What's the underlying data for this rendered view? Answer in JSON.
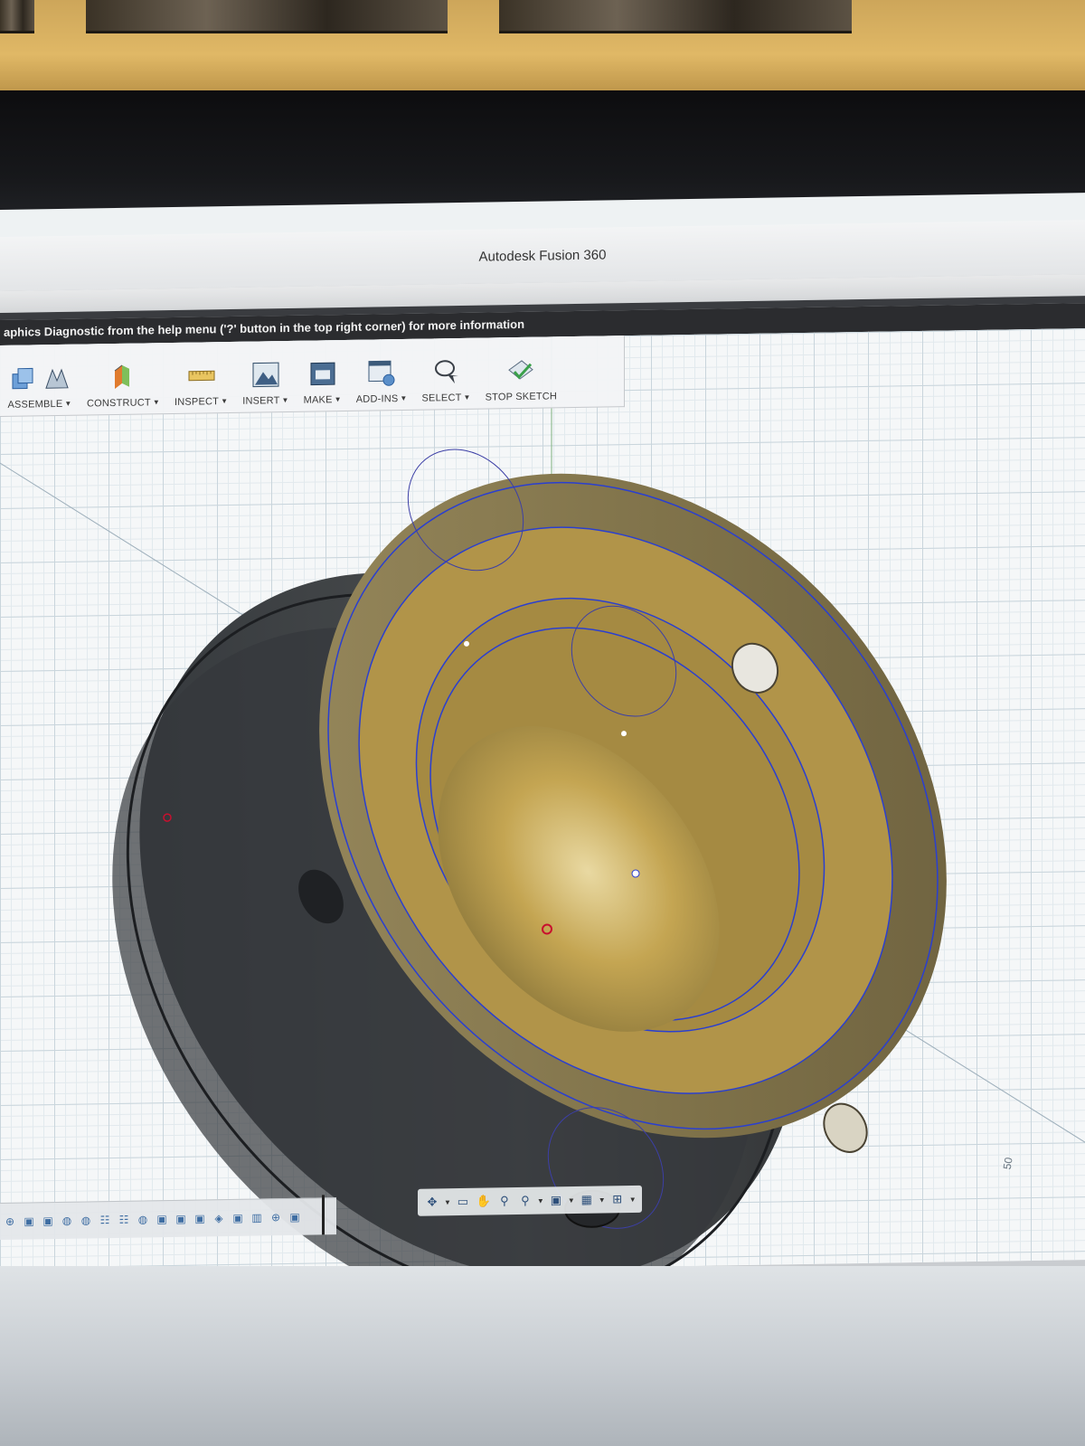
{
  "window": {
    "title": "Autodesk Fusion 360"
  },
  "warning_bar": {
    "text": "aphics Diagnostic from the help menu ('?' button in the top right corner) for more information"
  },
  "toolbar": {
    "groups": [
      {
        "label": "ASSEMBLE",
        "icons": [
          "new-component-icon",
          "joint-icon"
        ]
      },
      {
        "label": "CONSTRUCT",
        "icons": [
          "offset-plane-icon"
        ]
      },
      {
        "label": "INSPECT",
        "icons": [
          "measure-icon"
        ]
      },
      {
        "label": "INSERT",
        "icons": [
          "insert-image-icon"
        ]
      },
      {
        "label": "MAKE",
        "icons": [
          "3d-print-icon"
        ]
      },
      {
        "label": "ADD-INS",
        "icons": [
          "scripts-icon"
        ]
      },
      {
        "label": "SELECT",
        "icons": [
          "lasso-select-icon"
        ]
      },
      {
        "label": "STOP SKETCH",
        "icons": [
          "stop-sketch-icon"
        ]
      }
    ]
  },
  "viewport": {
    "axis_label": "50",
    "model_colors": {
      "body_outer": "#3f4347",
      "body_inner_tan": "#8a7c55",
      "bore_yellow": "#b89b4a",
      "sketch_line": "#2a3fd0",
      "sketch_point": "#c8102e"
    }
  },
  "navbar": {
    "icons": [
      "orbit-icon",
      "look-at-icon",
      "pan-icon",
      "zoom-window-icon",
      "zoom-icon",
      "display-settings-icon",
      "grid-settings-icon",
      "viewports-icon"
    ]
  },
  "timeline": {
    "item_count": 20
  }
}
